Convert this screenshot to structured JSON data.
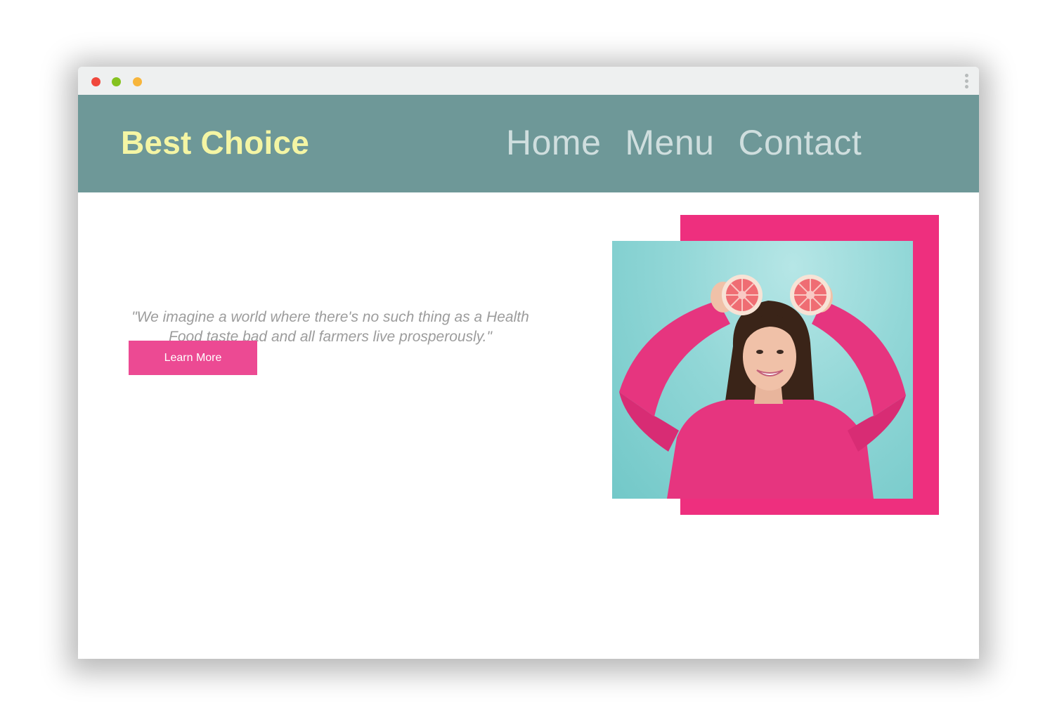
{
  "window": {
    "controls": [
      "close",
      "minimize",
      "maximize"
    ],
    "menu_icon": "kebab-menu-icon"
  },
  "header": {
    "brand": "Best Choice",
    "nav": [
      {
        "label": "Home"
      },
      {
        "label": "Menu"
      },
      {
        "label": "Contact"
      }
    ]
  },
  "hero": {
    "quote": "\"We imagine a world where there's no such thing as a Health Food taste bad and all farmers live prosperously.\"",
    "button_label": "Learn More",
    "image": "woman-holding-grapefruit-halves-photo"
  },
  "colors": {
    "header_bg": "#6e9898",
    "brand_text": "#f4f5a4",
    "nav_text": "#cfdede",
    "accent_pink": "#ec4a93",
    "frame_pink": "#ee2f7e",
    "photo_bg": "#92d7d7"
  }
}
